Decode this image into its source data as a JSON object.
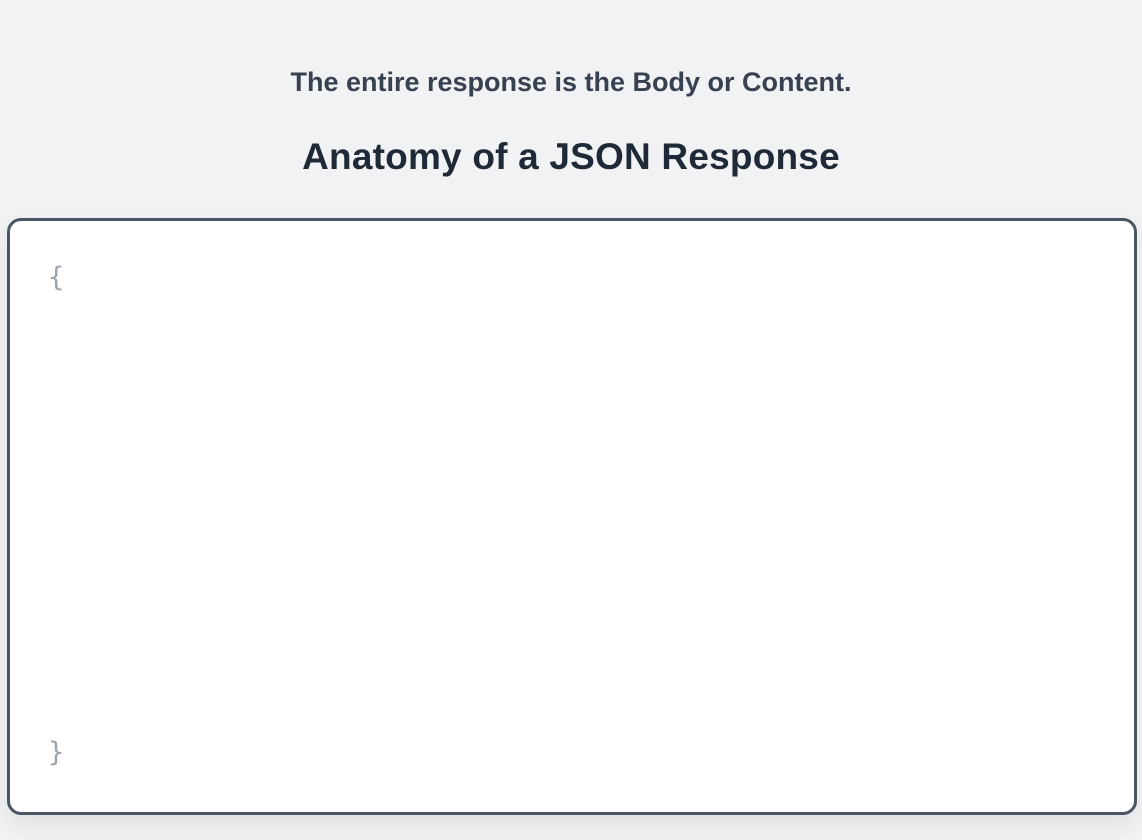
{
  "header": {
    "subtitle": "The entire response is the Body or Content.",
    "title": "Anatomy of a JSON Response"
  },
  "code": {
    "open_brace": "{",
    "close_brace": "}"
  }
}
